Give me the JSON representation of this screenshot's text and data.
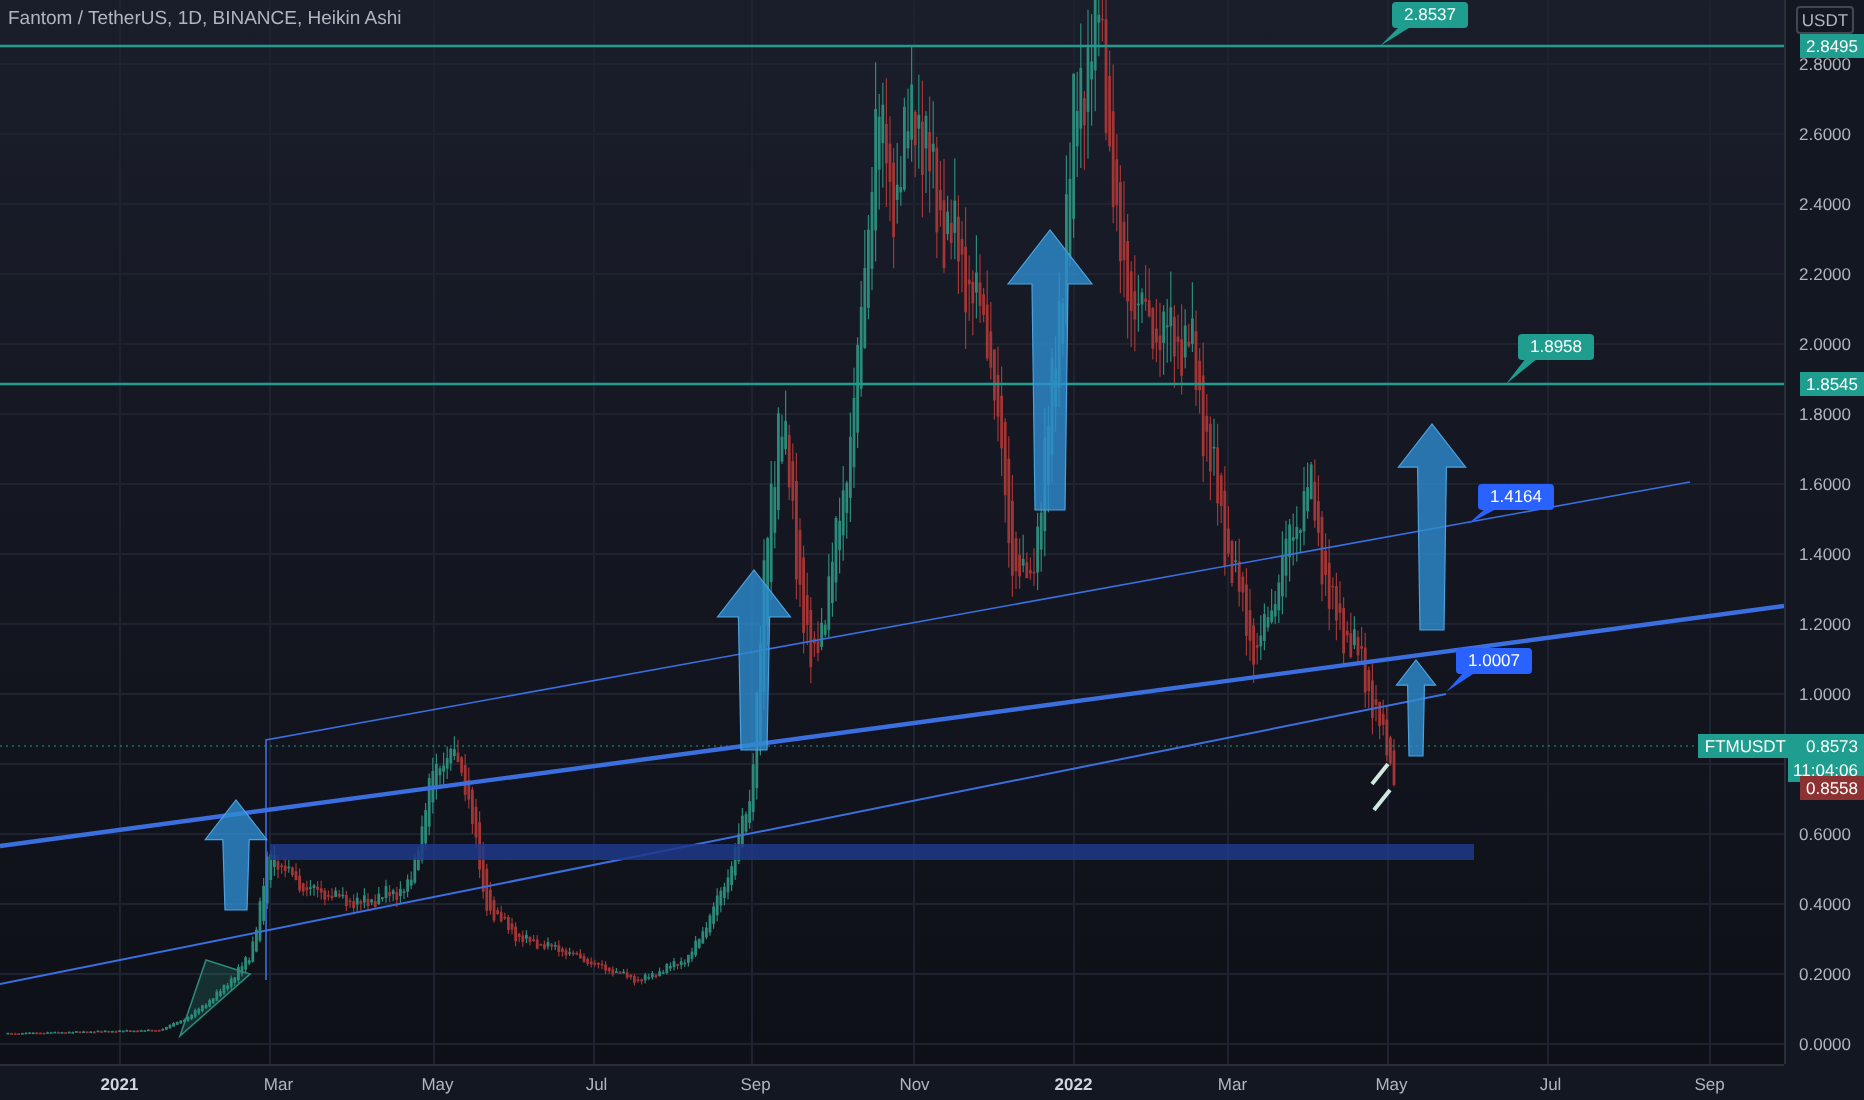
{
  "title": "Fantom / TetherUS, 1D, BINANCE, Heikin Ashi",
  "price_axis": {
    "unit": "USDT",
    "ticks": [
      "2.8000",
      "2.6000",
      "2.4000",
      "2.2000",
      "2.0000",
      "1.8000",
      "1.6000",
      "1.4000",
      "1.2000",
      "1.0000",
      "0.6000",
      "0.4000",
      "0.2000",
      "0.0000"
    ]
  },
  "time_axis": [
    {
      "label": "2021",
      "kind": "year"
    },
    {
      "label": "Mar",
      "kind": "month"
    },
    {
      "label": "May",
      "kind": "month"
    },
    {
      "label": "Jul",
      "kind": "month"
    },
    {
      "label": "Sep",
      "kind": "month"
    },
    {
      "label": "Nov",
      "kind": "month"
    },
    {
      "label": "2022",
      "kind": "year"
    },
    {
      "label": "Mar",
      "kind": "month"
    },
    {
      "label": "May",
      "kind": "month"
    },
    {
      "label": "Jul",
      "kind": "month"
    },
    {
      "label": "Sep",
      "kind": "month"
    }
  ],
  "callouts": [
    {
      "text": "2.8537",
      "color": "#1f9e90"
    },
    {
      "text": "1.8958",
      "color": "#1f9e90"
    },
    {
      "text": "1.4164",
      "color": "#2962ff"
    },
    {
      "text": "1.0007",
      "color": "#2962ff"
    }
  ],
  "price_tags": [
    {
      "text": "2.8495",
      "color": "#1f9e90"
    },
    {
      "text": "1.8545",
      "color": "#1f9e90"
    },
    {
      "symbol": "FTMUSDT",
      "text": "0.8573",
      "countdown": "11:04:06",
      "color": "#1f9e90"
    },
    {
      "text": "0.8558",
      "color": "#8c3232"
    }
  ]
}
